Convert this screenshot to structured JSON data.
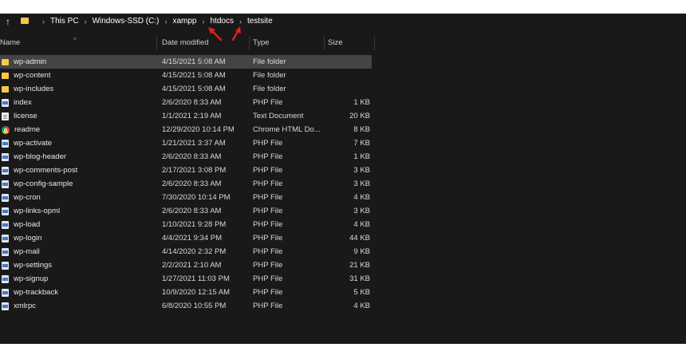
{
  "breadcrumb": [
    "This PC",
    "Windows-SSD (C:)",
    "xampp",
    "htdocs",
    "testsite"
  ],
  "columns": {
    "name": "Name",
    "date": "Date modified",
    "type": "Type",
    "size": "Size"
  },
  "accent": {
    "folder": "#f3c94a",
    "selected_row": "#444444",
    "arrow": "#e0201b"
  },
  "files": [
    {
      "name": "wp-admin",
      "date": "4/15/2021 5:08 AM",
      "type": "File folder",
      "size": "",
      "icon": "folder-icon"
    },
    {
      "name": "wp-content",
      "date": "4/15/2021 5:08 AM",
      "type": "File folder",
      "size": "",
      "icon": "folder-icon"
    },
    {
      "name": "wp-includes",
      "date": "4/15/2021 5:08 AM",
      "type": "File folder",
      "size": "",
      "icon": "folder-icon"
    },
    {
      "name": "index",
      "date": "2/6/2020 8:33 AM",
      "type": "PHP File",
      "size": "1 KB",
      "icon": "php-file-icon"
    },
    {
      "name": "license",
      "date": "1/1/2021 2:19 AM",
      "type": "Text Document",
      "size": "20 KB",
      "icon": "text-document-icon"
    },
    {
      "name": "readme",
      "date": "12/29/2020 10:14 PM",
      "type": "Chrome HTML Do...",
      "size": "8 KB",
      "icon": "chrome-icon"
    },
    {
      "name": "wp-activate",
      "date": "1/21/2021 3:37 AM",
      "type": "PHP File",
      "size": "7 KB",
      "icon": "php-file-icon"
    },
    {
      "name": "wp-blog-header",
      "date": "2/6/2020 8:33 AM",
      "type": "PHP File",
      "size": "1 KB",
      "icon": "php-file-icon"
    },
    {
      "name": "wp-comments-post",
      "date": "2/17/2021 3:08 PM",
      "type": "PHP File",
      "size": "3 KB",
      "icon": "php-file-icon"
    },
    {
      "name": "wp-config-sample",
      "date": "2/6/2020 8:33 AM",
      "type": "PHP File",
      "size": "3 KB",
      "icon": "php-file-icon"
    },
    {
      "name": "wp-cron",
      "date": "7/30/2020 10:14 PM",
      "type": "PHP File",
      "size": "4 KB",
      "icon": "php-file-icon"
    },
    {
      "name": "wp-links-opml",
      "date": "2/6/2020 8:33 AM",
      "type": "PHP File",
      "size": "3 KB",
      "icon": "php-file-icon"
    },
    {
      "name": "wp-load",
      "date": "1/10/2021 9:28 PM",
      "type": "PHP File",
      "size": "4 KB",
      "icon": "php-file-icon"
    },
    {
      "name": "wp-login",
      "date": "4/4/2021 9:34 PM",
      "type": "PHP File",
      "size": "44 KB",
      "icon": "php-file-icon"
    },
    {
      "name": "wp-mail",
      "date": "4/14/2020 2:32 PM",
      "type": "PHP File",
      "size": "9 KB",
      "icon": "php-file-icon"
    },
    {
      "name": "wp-settings",
      "date": "2/2/2021 2:10 AM",
      "type": "PHP File",
      "size": "21 KB",
      "icon": "php-file-icon"
    },
    {
      "name": "wp-signup",
      "date": "1/27/2021 11:03 PM",
      "type": "PHP File",
      "size": "31 KB",
      "icon": "php-file-icon"
    },
    {
      "name": "wp-trackback",
      "date": "10/9/2020 12:15 AM",
      "type": "PHP File",
      "size": "5 KB",
      "icon": "php-file-icon"
    },
    {
      "name": "xmlrpc",
      "date": "6/8/2020 10:55 PM",
      "type": "PHP File",
      "size": "4 KB",
      "icon": "php-file-icon"
    }
  ]
}
